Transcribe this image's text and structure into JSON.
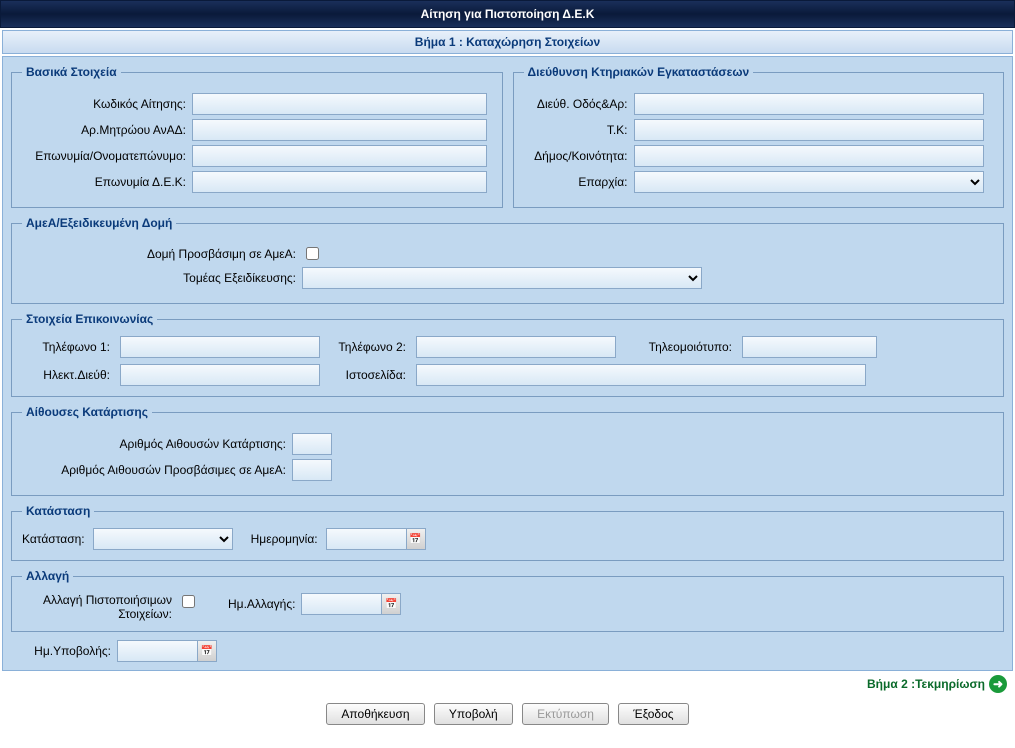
{
  "window": {
    "title": "Αίτηση για Πιστοποίηση Δ.Ε.Κ"
  },
  "step": {
    "label": "Βήμα 1 : Καταχώρηση Στοιχείων"
  },
  "basic": {
    "legend": "Βασικά Στοιχεία",
    "code_label": "Κωδικός Αίτησης:",
    "registry_label": "Αρ.Μητρώου ΑνΑΔ:",
    "name_label": "Επωνυμία/Ονοματεπώνυμο:",
    "dek_label": "Επωνυμία Δ.Ε.Κ:",
    "code": "",
    "registry": "",
    "name": "",
    "dek": ""
  },
  "address": {
    "legend": "Διεύθυνση Κτηριακών Εγκαταστάσεων",
    "street_label": "Διεύθ. Οδός&Αρ:",
    "postal_label": "Τ.Κ:",
    "municipality_label": "Δήμος/Κοινότητα:",
    "district_label": "Επαρχία:",
    "street": "",
    "postal": "",
    "municipality": "",
    "district": ""
  },
  "amea": {
    "legend": "ΑμεΑ/Εξειδικευμένη Δομή",
    "accessible_label": "Δομή Προσβάσιμη σε ΑμεΑ:",
    "specialization_label": "Τομέας Εξειδίκευσης:",
    "specialization": ""
  },
  "contact": {
    "legend": "Στοιχεία Επικοινωνίας",
    "phone1_label": "Τηλέφωνο 1:",
    "phone2_label": "Τηλέφωνο 2:",
    "fax_label": "Τηλεομοιότυπο:",
    "email_label": "Ηλεκτ.Διεύθ:",
    "website_label": "Ιστοσελίδα:",
    "phone1": "",
    "phone2": "",
    "fax": "",
    "email": "",
    "website": ""
  },
  "rooms": {
    "legend": "Αίθουσες Κατάρτισης",
    "count_label": "Αριθμός Αιθουσών Κατάρτισης:",
    "accessible_label": "Αριθμός Αιθουσών Προσβάσιμες σε ΑμεΑ:",
    "count": "",
    "accessible": ""
  },
  "status": {
    "legend": "Κατάσταση",
    "status_label": "Κατάσταση:",
    "date_label": "Ημερομηνία:",
    "status": "",
    "date": ""
  },
  "change": {
    "legend": "Αλλαγή",
    "change_label": "Αλλαγή Πιστοποιήσιμων Στοιχείων:",
    "date_label": "Ημ.Αλλαγής:",
    "date": ""
  },
  "submission": {
    "date_label": "Ημ.Υποβολής:",
    "date": ""
  },
  "nav": {
    "next_label": "Βήμα 2 :Τεκμηρίωση"
  },
  "buttons": {
    "save": "Αποθήκευση",
    "submit": "Υποβολή",
    "print": "Εκτύπωση",
    "exit": "Έξοδος"
  },
  "icons": {
    "calendar": "📅",
    "arrow": "➜"
  }
}
